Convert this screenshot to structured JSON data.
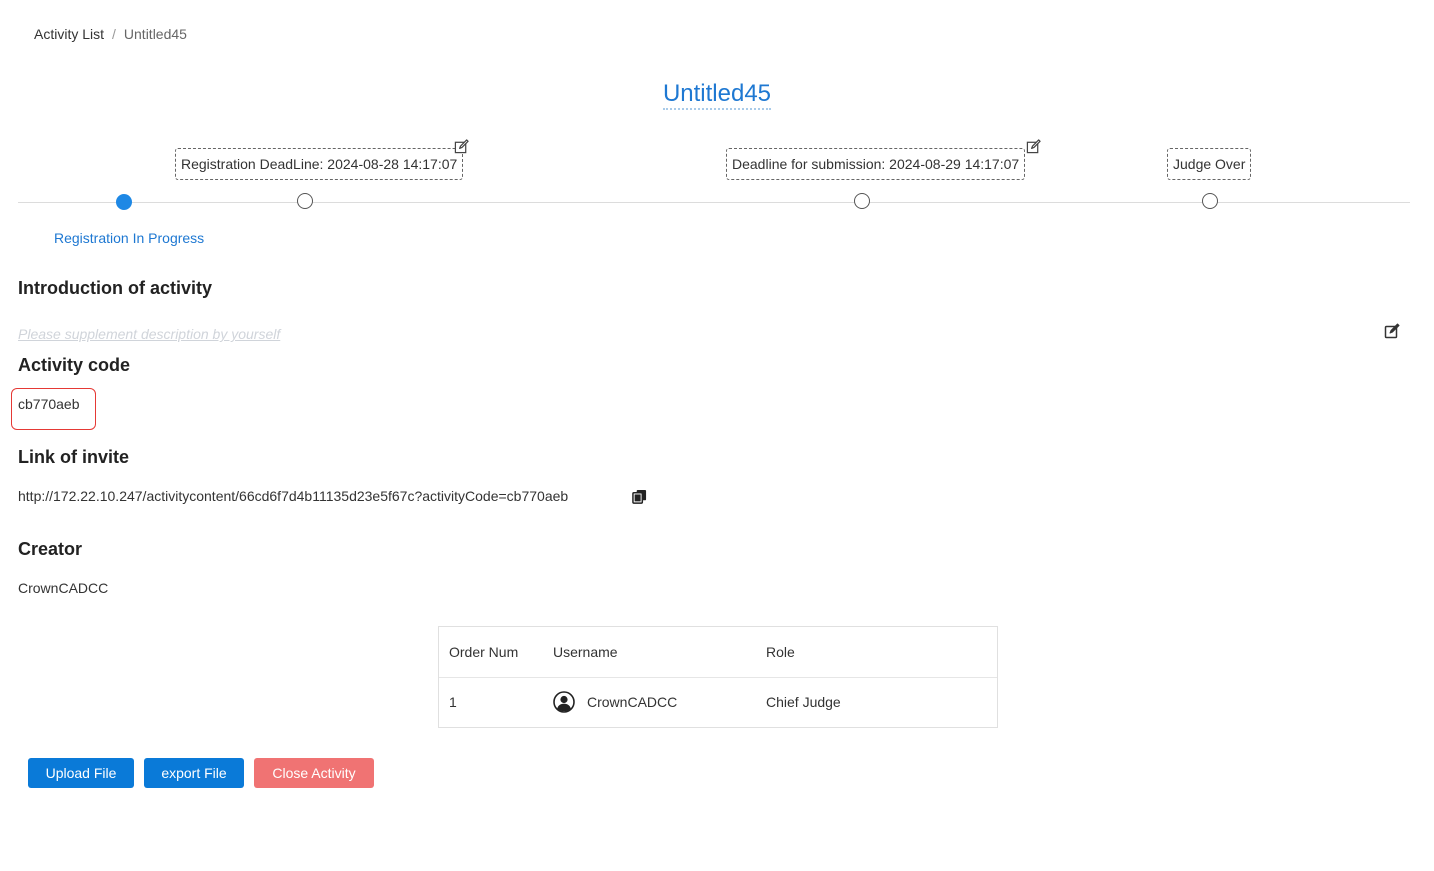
{
  "breadcrumb": {
    "root": "Activity List",
    "separator": "/",
    "current": "Untitled45"
  },
  "activity": {
    "title": "Untitled45"
  },
  "timeline": {
    "registration_deadline": "Registration DeadLine: 2024-08-28 14:17:07",
    "submission_deadline": "Deadline for submission: 2024-08-29 14:17:07",
    "judge_over": "Judge Over",
    "status": "Registration In Progress"
  },
  "sections": {
    "intro_heading": "Introduction of activity",
    "intro_placeholder": "Please supplement description by yourself",
    "code_heading": "Activity code",
    "code_value": "cb770aeb",
    "invite_heading": "Link of invite",
    "invite_link": "http://172.22.10.247/activitycontent/66cd6f7d4b11135d23e5f67c?activityCode=cb770aeb",
    "creator_heading": "Creator",
    "creator_name": "CrownCADCC"
  },
  "table": {
    "columns": [
      "Order Num",
      "Username",
      "Role"
    ],
    "rows": [
      {
        "order": "1",
        "username": "CrownCADCC",
        "role": "Chief Judge"
      }
    ]
  },
  "buttons": {
    "upload": "Upload File",
    "export": "export File",
    "close": "Close Activity"
  },
  "colors": {
    "accent": "#1e78d2",
    "primary_button": "#0a7ad8",
    "danger_button": "#f07373",
    "highlight_border": "#e53935"
  },
  "icons": {
    "edit": "edit-icon",
    "copy": "copy-icon",
    "user": "user-avatar-icon"
  }
}
